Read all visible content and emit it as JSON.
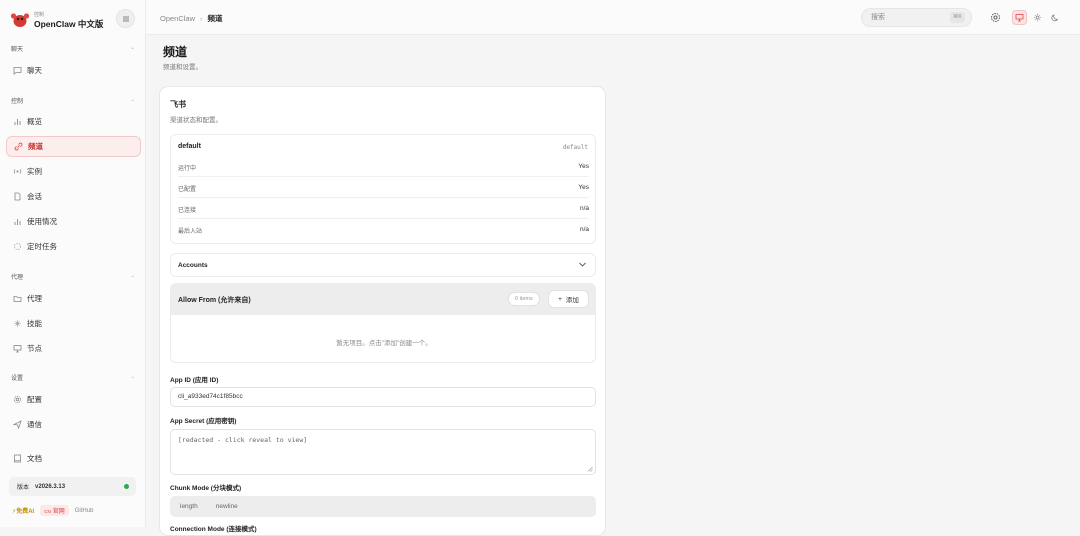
{
  "brand": {
    "small": "控制",
    "name": "OpenClaw 中文版"
  },
  "sidebar": {
    "sections": [
      {
        "label": "聊天"
      },
      {
        "label": "控制"
      },
      {
        "label": "代理"
      },
      {
        "label": "设置"
      }
    ],
    "items": [
      {
        "label": "聊天",
        "icon": "chat-icon"
      },
      {
        "label": "概览",
        "icon": "bar-chart-icon"
      },
      {
        "label": "频道",
        "icon": "link-icon",
        "active": true
      },
      {
        "label": "实例",
        "icon": "radio-icon"
      },
      {
        "label": "会话",
        "icon": "document-icon"
      },
      {
        "label": "使用情况",
        "icon": "bar-chart-icon"
      },
      {
        "label": "定时任务",
        "icon": "loader-icon"
      },
      {
        "label": "代理",
        "icon": "folder-icon"
      },
      {
        "label": "技能",
        "icon": "sparkle-icon"
      },
      {
        "label": "节点",
        "icon": "monitor-icon"
      },
      {
        "label": "配置",
        "icon": "gear-icon"
      },
      {
        "label": "通信",
        "icon": "send-icon"
      },
      {
        "label": "文档",
        "icon": "book-icon"
      }
    ],
    "version_label": "版本",
    "version_value": "v2026.3.13",
    "footer": {
      "free": "免费AI",
      "site": "官网",
      "site_prefix": "CN",
      "github": "GitHub"
    }
  },
  "topbar": {
    "breadcrumb_root": "OpenClaw",
    "breadcrumb_sep": "›",
    "breadcrumb_current": "频道",
    "search_placeholder": "搜索",
    "search_kbd": "⌘K"
  },
  "page": {
    "title": "频道",
    "subtitle": "频道和设置。"
  },
  "card": {
    "title": "飞书",
    "subtitle": "渠道状态和配置。",
    "account": {
      "name": "default",
      "id": "default",
      "rows": [
        {
          "key": "运行中",
          "value": "Yes"
        },
        {
          "key": "已配置",
          "value": "Yes"
        },
        {
          "key": "已连接",
          "value": "n/a"
        },
        {
          "key": "最后入站",
          "value": "n/a"
        }
      ]
    },
    "accounts_label": "Accounts",
    "allow_from": {
      "label": "Allow From (允许来自)",
      "count": "0 items",
      "add": "添加",
      "empty": "暂无项目。点击\"添加\"创建一个。"
    },
    "app_id_label": "App ID (应用 ID)",
    "app_id_value": "cli_a933ed74c1f85bcc",
    "app_secret_label": "App Secret (应用密钥)",
    "app_secret_value": "[redacted - click reveal to view]",
    "chunk_mode_label": "Chunk Mode (分块模式)",
    "chunk_options": [
      "length",
      "newline"
    ],
    "next_label": "Connection Mode (连接模式)"
  },
  "colors": {
    "accent": "#d9534f",
    "status_ok": "#2eaa4a"
  }
}
